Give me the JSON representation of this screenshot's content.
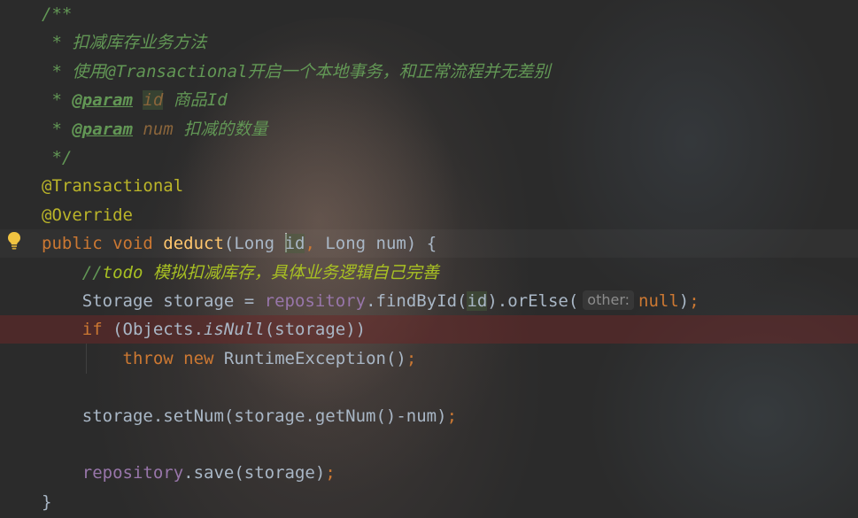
{
  "editor": {
    "lines": [
      {
        "tokens": [
          {
            "t": "/**",
            "c": "cmt"
          }
        ]
      },
      {
        "tokens": [
          {
            "t": " * 扣减库存业务方法",
            "c": "cmt"
          }
        ]
      },
      {
        "tokens": [
          {
            "t": " * 使用@Transactional开启一个本地事务，和正常流程并无差别",
            "c": "cmt"
          }
        ]
      },
      {
        "tokens": [
          {
            "t": " * ",
            "c": "cmt"
          },
          {
            "t": "@param",
            "c": "cmt-tag"
          },
          {
            "t": " ",
            "c": "cmt"
          },
          {
            "t": "id",
            "c": "cmt-param hl-id"
          },
          {
            "t": " 商品Id",
            "c": "cmt"
          }
        ]
      },
      {
        "tokens": [
          {
            "t": " * ",
            "c": "cmt"
          },
          {
            "t": "@param",
            "c": "cmt-tag"
          },
          {
            "t": " ",
            "c": "cmt"
          },
          {
            "t": "num",
            "c": "cmt-param"
          },
          {
            "t": " 扣减的数量",
            "c": "cmt"
          }
        ]
      },
      {
        "tokens": [
          {
            "t": " */",
            "c": "cmt"
          }
        ]
      },
      {
        "tokens": [
          {
            "t": "@Transactional",
            "c": "anno"
          }
        ]
      },
      {
        "tokens": [
          {
            "t": "@Override",
            "c": "anno"
          }
        ]
      },
      {
        "tokens": [
          {
            "t": "public ",
            "c": "kw"
          },
          {
            "t": "void ",
            "c": "kw"
          },
          {
            "t": "deduct",
            "c": "fn"
          },
          {
            "t": "(Long ",
            "c": ""
          },
          {
            "t": "caret",
            "c": "caret"
          },
          {
            "t": "id",
            "c": "hl-id"
          },
          {
            "t": ", ",
            "c": "kw"
          },
          {
            "t": "Long num) {",
            "c": ""
          }
        ],
        "caret_line": true
      },
      {
        "tokens": [
          {
            "t": "    //",
            "c": "cmt"
          },
          {
            "t": "todo",
            "c": "todo"
          },
          {
            "t": " 模拟扣减库存，具体业务逻辑自己完善",
            "c": "todo"
          }
        ]
      },
      {
        "tokens": [
          {
            "t": "    Storage storage = ",
            "c": ""
          },
          {
            "t": "repository",
            "c": "field"
          },
          {
            "t": ".findById(",
            "c": ""
          },
          {
            "t": "id",
            "c": "hl-id"
          },
          {
            "t": ").orElse(",
            "c": ""
          },
          {
            "t": "other:",
            "c": "hint"
          },
          {
            "t": "null",
            "c": "kw"
          },
          {
            "t": ")",
            "c": ""
          },
          {
            "t": ";",
            "c": "kw"
          }
        ]
      },
      {
        "tokens": [
          {
            "t": "    ",
            "c": ""
          },
          {
            "t": "if ",
            "c": "kw"
          },
          {
            "t": "(Objects.",
            "c": ""
          },
          {
            "t": "isNull",
            "c": "italic"
          },
          {
            "t": "(storage))",
            "c": ""
          }
        ],
        "error": true
      },
      {
        "tokens": [
          {
            "t": "        ",
            "c": ""
          },
          {
            "t": "throw ",
            "c": "kw"
          },
          {
            "t": "new ",
            "c": "kw"
          },
          {
            "t": "RuntimeException()",
            "c": ""
          },
          {
            "t": ";",
            "c": "kw"
          }
        ]
      },
      {
        "tokens": [
          {
            "t": "",
            "c": ""
          }
        ]
      },
      {
        "tokens": [
          {
            "t": "    storage.setNum(storage.getNum()-num)",
            "c": ""
          },
          {
            "t": ";",
            "c": "kw"
          }
        ]
      },
      {
        "tokens": [
          {
            "t": "",
            "c": ""
          }
        ]
      },
      {
        "tokens": [
          {
            "t": "    ",
            "c": ""
          },
          {
            "t": "repository",
            "c": "field"
          },
          {
            "t": ".save(storage)",
            "c": ""
          },
          {
            "t": ";",
            "c": "kw"
          }
        ]
      },
      {
        "tokens": [
          {
            "t": "}",
            "c": ""
          }
        ]
      }
    ]
  },
  "gutter": {
    "intention_icon": "lightbulb-icon",
    "intention_color": "#f0c23b"
  },
  "colors": {
    "background": "#2b2b2b",
    "keyword": "#cc7832",
    "method": "#ffc66d",
    "field": "#9876aa",
    "comment": "#629755",
    "annotation": "#bbb529",
    "todo": "#a8c023",
    "text": "#a9b7c6"
  }
}
